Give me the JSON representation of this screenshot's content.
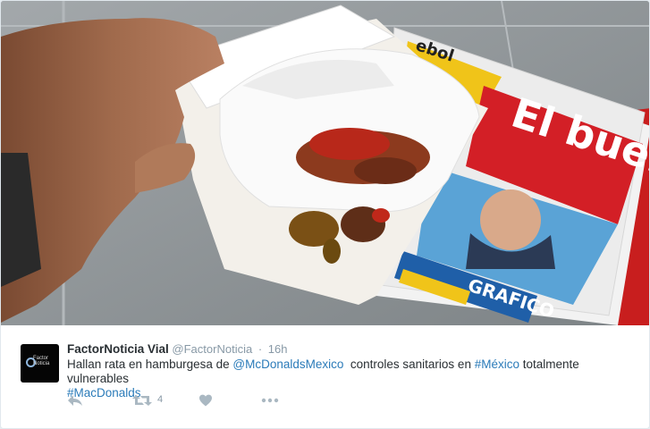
{
  "tweet": {
    "avatar_text": "Factor Noticia",
    "name": "FactorNoticia Vial",
    "handle": "@FactorNoticia",
    "separator": "·",
    "time": "16h",
    "text_part1": "Hallan rata en hamburgesa de ",
    "mention": "@McDonaldsMexico",
    "text_part2": "  controles sanitarios en ",
    "hashtag1": "#México",
    "text_part3": " totalmente vulnerables",
    "hashtag2": "#MacDonalds",
    "retweet_count": "4"
  },
  "photo": {
    "newspaper_headline": "El buen",
    "newspaper_footer": "GRAFICO",
    "newspaper_top": "ebol"
  },
  "icons": {
    "reply": "reply-icon",
    "retweet": "retweet-icon",
    "like": "heart-icon",
    "more": "more-icon"
  },
  "colors": {
    "name": "#292f33",
    "meta": "#8899a6",
    "link": "#2b7bb9",
    "icon": "#aab8c2"
  }
}
